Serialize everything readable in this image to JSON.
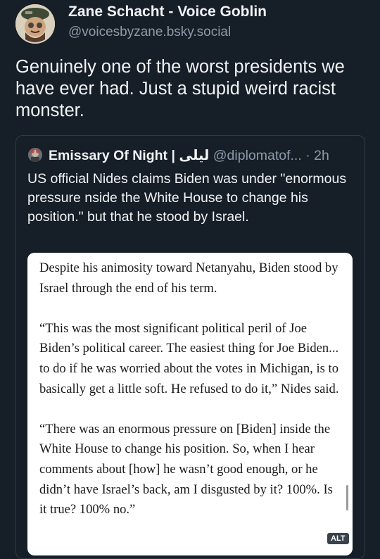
{
  "post": {
    "author_name": "Zane Schacht - Voice Goblin",
    "author_handle": "@voicesbyzane.bsky.social",
    "text": "Genuinely one of the worst presidents we have ever had. Just a stupid weird racist monster."
  },
  "quote": {
    "author_name": "Emissary Of Night | ليلى",
    "author_handle": "@diplomatof...",
    "separator": "·",
    "time": "2h",
    "text": "US official Nides claims Biden was under \"enormous pressure nside the White House to change his position.\" but that he stood by Israel.",
    "image": {
      "paragraphs": [
        "Despite his animosity toward Netanyahu, Biden stood by Israel through the end of his term.",
        "“This was the most significant political peril of Joe Biden’s political career. The easiest thing for Joe Biden... to do if he was worried about the votes in Michigan, is to basically get a little soft. He refused to do it,” Nides said.",
        "“There was an enormous pressure on [Biden] inside the White House to change his position. So, when I hear comments about [how] he wasn’t good enough, or he didn’t have Israel’s back, am I disgusted by it? 100%. Is it true? 100% no.”"
      ],
      "alt_badge": "ALT"
    }
  },
  "colors": {
    "background": "#161e27",
    "text_primary": "#f1f3f5",
    "text_secondary": "#8d9aa8",
    "card_border": "#2e3a48"
  },
  "icons": {
    "avatar": "cartoon-goblin-avatar",
    "quote_avatar": "profile-avatar"
  }
}
